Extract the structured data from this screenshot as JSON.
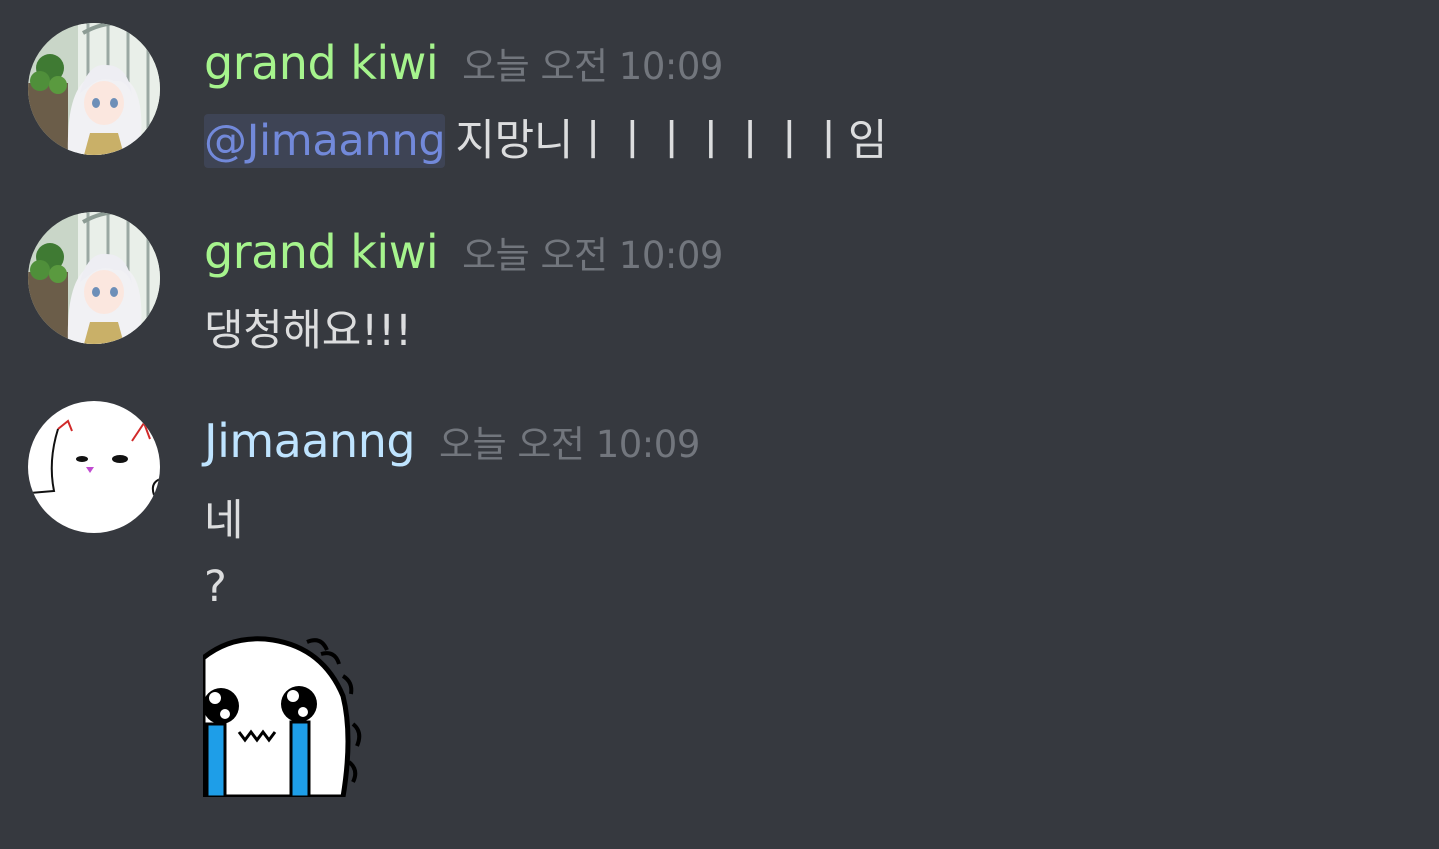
{
  "messages": [
    {
      "author": "grand kiwi",
      "author_color": "#a6f48d",
      "timestamp": "오늘 오전 10:09",
      "mention": "@Jimaanng",
      "text": "지망니ㅣㅣㅣㅣㅣㅣㅣ임"
    },
    {
      "author": "grand kiwi",
      "author_color": "#a6f48d",
      "timestamp": "오늘 오전 10:09",
      "text": "댕청해요!!!"
    },
    {
      "author": "Jimaanng",
      "author_color": "#bfe4ff",
      "timestamp": "오늘 오전 10:09",
      "lines": [
        "네",
        "?"
      ],
      "sticker": "crying-face-sticker"
    }
  ],
  "colors": {
    "background": "#36393f",
    "text": "#dcddde",
    "timestamp": "#72767d",
    "mention": "#7289da"
  },
  "icons": {
    "avatar_grand_kiwi": "anime-girl-avatar",
    "avatar_jimaanng": "white-cat-avatar",
    "sticker": "crying-face-sticker"
  }
}
